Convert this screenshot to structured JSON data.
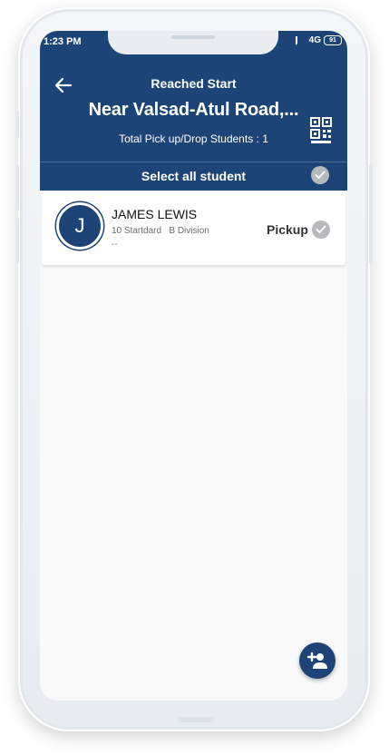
{
  "status_bar": {
    "time": "1:23 PM",
    "network": "4G",
    "battery": "91"
  },
  "header": {
    "back_icon": "arrow-left-icon",
    "subtitle": "Reached Start",
    "title": "Near Valsad-Atul Road,...",
    "count_text": "Total Pick up/Drop Students : 1",
    "qr_icon": "qr-code-icon"
  },
  "select_all": {
    "label": "Select all student",
    "checked": true
  },
  "students": [
    {
      "initial": "J",
      "name": "JAMES LEWIS",
      "standard": "10 Startdard",
      "division": "B Division",
      "extra": "--",
      "status": "Pickup",
      "checked": true
    }
  ],
  "fab": {
    "icon": "add-person-icon"
  },
  "colors": {
    "primary": "#1d4477",
    "check": "#b7b9bd",
    "screen_bg": "#f9f9f9"
  }
}
